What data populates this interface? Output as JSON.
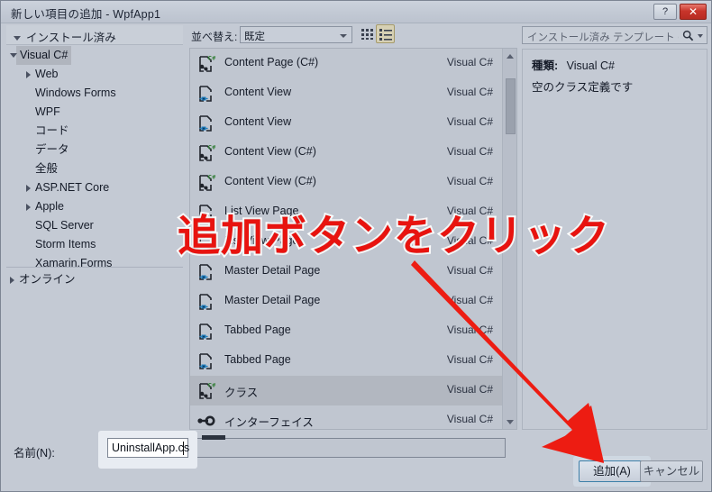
{
  "window": {
    "title": "新しい項目の追加 - WpfApp1",
    "help_label": "?",
    "close_label": "✕"
  },
  "tree": {
    "header": "インストール済み",
    "items": [
      {
        "label": "Visual C#",
        "level": 1,
        "expander": "down",
        "selected": true
      },
      {
        "label": "Web",
        "level": 2,
        "expander": "right",
        "selected": false
      },
      {
        "label": "Windows Forms",
        "level": 2,
        "expander": "none",
        "selected": false
      },
      {
        "label": "WPF",
        "level": 2,
        "expander": "none",
        "selected": false
      },
      {
        "label": "コード",
        "level": 2,
        "expander": "none",
        "selected": false
      },
      {
        "label": "データ",
        "level": 2,
        "expander": "none",
        "selected": false
      },
      {
        "label": "全般",
        "level": 2,
        "expander": "none",
        "selected": false
      },
      {
        "label": "ASP.NET Core",
        "level": 2,
        "expander": "right",
        "selected": false
      },
      {
        "label": "Apple",
        "level": 2,
        "expander": "right",
        "selected": false
      },
      {
        "label": "SQL Server",
        "level": 2,
        "expander": "none",
        "selected": false
      },
      {
        "label": "Storm Items",
        "level": 2,
        "expander": "none",
        "selected": false
      },
      {
        "label": "Xamarin.Forms",
        "level": 2,
        "expander": "none",
        "selected": false
      }
    ],
    "online_label": "オンライン"
  },
  "toolbar": {
    "sort_label": "並べ替え:",
    "sort_value": "既定",
    "grid_view_icon": "grid-view-icon",
    "list_view_icon": "list-view-icon"
  },
  "templates": {
    "lang_default": "Visual C#",
    "rows": [
      {
        "name": "Content Page (C#)",
        "lang": "Visual C#",
        "icon": "csharp-page-icon",
        "selected": false
      },
      {
        "name": "Content View",
        "lang": "Visual C#",
        "icon": "xaml-view-icon",
        "selected": false
      },
      {
        "name": "Content View",
        "lang": "Visual C#",
        "icon": "xaml-view-icon",
        "selected": false
      },
      {
        "name": "Content View (C#)",
        "lang": "Visual C#",
        "icon": "csharp-page-icon",
        "selected": false
      },
      {
        "name": "Content View (C#)",
        "lang": "Visual C#",
        "icon": "csharp-page-icon",
        "selected": false
      },
      {
        "name": "List View Page",
        "lang": "Visual C#",
        "icon": "xaml-view-icon",
        "selected": false
      },
      {
        "name": "List View Page",
        "lang": "Visual C#",
        "icon": "xaml-view-icon",
        "selected": false
      },
      {
        "name": "Master Detail Page",
        "lang": "Visual C#",
        "icon": "xaml-view-icon",
        "selected": false
      },
      {
        "name": "Master Detail Page",
        "lang": "Visual C#",
        "icon": "xaml-view-icon",
        "selected": false
      },
      {
        "name": "Tabbed Page",
        "lang": "Visual C#",
        "icon": "xaml-view-icon",
        "selected": false
      },
      {
        "name": "Tabbed Page",
        "lang": "Visual C#",
        "icon": "xaml-view-icon",
        "selected": false
      },
      {
        "name": "クラス",
        "lang": "Visual C#",
        "icon": "csharp-class-icon",
        "selected": true
      },
      {
        "name": "インターフェイス",
        "lang": "Visual C#",
        "icon": "interface-icon",
        "selected": false
      },
      {
        "name": "",
        "lang": "",
        "icon": "xaml-view-icon",
        "selected": false
      }
    ]
  },
  "search": {
    "placeholder": "インストール済み テンプレート の検索"
  },
  "detail": {
    "kind_label": "種類:",
    "kind_value": "Visual C#",
    "description": "空のクラス定義です"
  },
  "bottom": {
    "name_label": "名前(N):",
    "name_value": "UninstallApp.cs",
    "add_label": "追加(A)",
    "cancel_label": "キャンセル"
  },
  "annotation": {
    "text": "追加ボタンをクリック",
    "color": "#e8130f",
    "outline_color": "#ffffff"
  }
}
